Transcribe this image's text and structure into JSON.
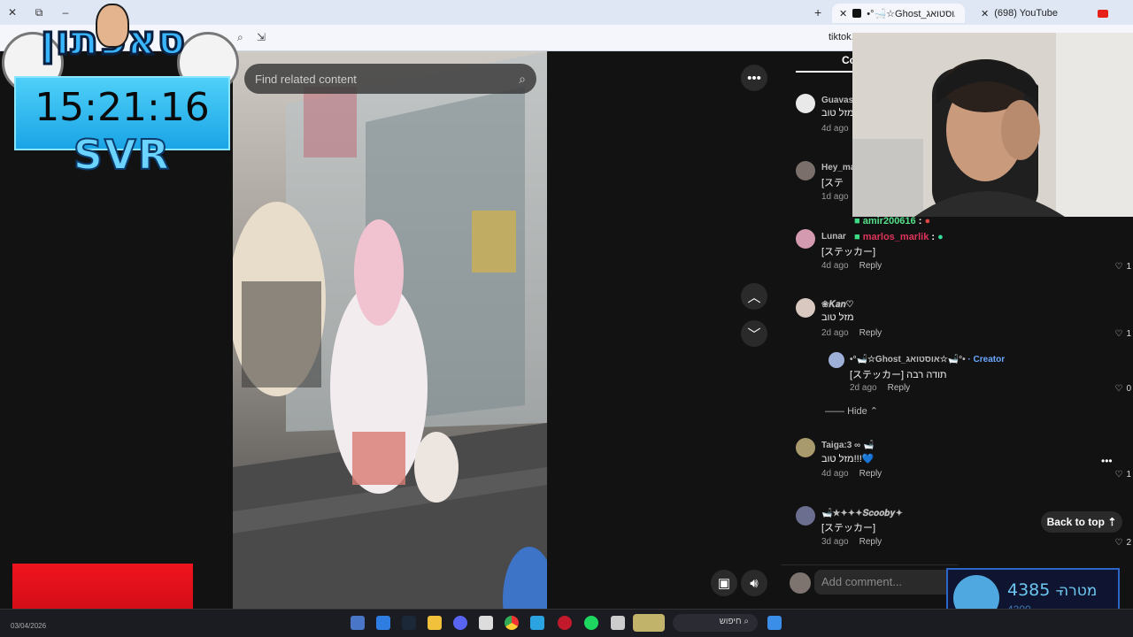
{
  "browser": {
    "tabs": [
      {
        "label": "•°🛁☆Ghost_אוסטואג☆🛁°•"
      },
      {
        "label": "(698) YouTube"
      }
    ],
    "url": "tiktok.c"
  },
  "video_page": {
    "search_placeholder": "Find related content",
    "comments_tab_label": "Co"
  },
  "comments": [
    {
      "user": "GuavasW",
      "text": "מזל טוב",
      "time": "4d ago",
      "reply": "",
      "likes": ""
    },
    {
      "user": "Hey_ma",
      "text": "[ステ",
      "time": "1d ago",
      "reply": "",
      "likes": ""
    },
    {
      "user": "Lunar",
      "text": "[ステッカー]",
      "time": "4d ago",
      "reply": "Reply",
      "likes": "1"
    },
    {
      "user": "❀𝑲𝒂𝒏♡",
      "text": "מזל טוב",
      "time": "2d ago",
      "reply": "Reply",
      "likes": "1"
    },
    {
      "user": "•°🛁☆Ghost_אוסטואג☆🛁°•",
      "creator": "· Creator",
      "text": "[ステッカー] תודה רבה",
      "time": "2d ago",
      "reply": "Reply",
      "likes": "0"
    },
    {
      "user": "Taiga:3 ∞ 🛁",
      "text": "מזל טוב!!!💙",
      "time": "4d ago",
      "reply": "Reply",
      "likes": "1"
    },
    {
      "user": "🛁★✦✦✦𝑺𝒄𝒐𝒐𝒃𝒚✦",
      "text": "[ステッカー]",
      "time": "3d ago",
      "reply": "Reply",
      "likes": "2"
    }
  ],
  "hide_label": "Hide",
  "back_to_top": "Back to top",
  "add_comment_placeholder": "Add comment...",
  "stream_overlay": {
    "logo_text": "סאפתון",
    "clock": "15:21:16",
    "clock_sub": "SVR",
    "chat": [
      {
        "user": "amir200616",
        "sep": ":",
        "color": "#55e08a"
      },
      {
        "user": "marlos_marlik",
        "sep": ":",
        "color": "#e0335a"
      }
    ],
    "goal_value": "4385",
    "goal_dash": "–",
    "goal_label": "מטרה",
    "goal_target": "4200"
  },
  "taskbar": {
    "search_label": "חיפוש",
    "date": "03/04/2026"
  },
  "colors": {
    "accent_creator": "#6aa8ff",
    "page_bg": "#121212",
    "brand_goal": "#6bc6f0"
  }
}
